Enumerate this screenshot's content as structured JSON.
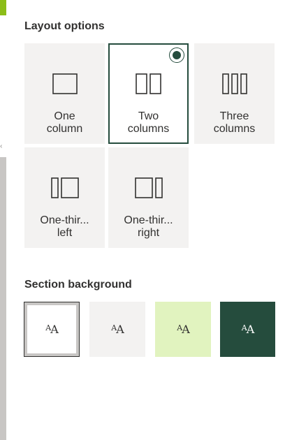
{
  "layout_options": {
    "title": "Layout options",
    "selected": "two-columns",
    "tiles": [
      {
        "id": "one-column",
        "label": "One\ncolumn",
        "selected": false
      },
      {
        "id": "two-columns",
        "label": "Two\ncolumns",
        "selected": true
      },
      {
        "id": "three-columns",
        "label": "Three\ncolumns",
        "selected": false
      },
      {
        "id": "one-third-left",
        "label": "One-thir...\nleft",
        "selected": false
      },
      {
        "id": "one-third-right",
        "label": "One-thir...\nright",
        "selected": false
      }
    ]
  },
  "section_background": {
    "title": "Section background",
    "selected": "none",
    "swatches": [
      {
        "id": "none",
        "glyph_small": "A",
        "glyph_big": "A",
        "background": "#ffffff",
        "text_color": "#323130",
        "selected": true
      },
      {
        "id": "neutral",
        "glyph_small": "A",
        "glyph_big": "A",
        "background": "#f3f2f1",
        "text_color": "#323130",
        "selected": false
      },
      {
        "id": "soft",
        "glyph_small": "A",
        "glyph_big": "A",
        "background": "#e1f3bf",
        "text_color": "#323130",
        "selected": false
      },
      {
        "id": "strong",
        "glyph_small": "A",
        "glyph_big": "A",
        "background": "#254c3d",
        "text_color": "#ffffff",
        "selected": false
      }
    ]
  },
  "colors": {
    "accent": "#254c3d",
    "tile_bg": "#f3f2f1",
    "left_accent": "#8cbd18"
  }
}
